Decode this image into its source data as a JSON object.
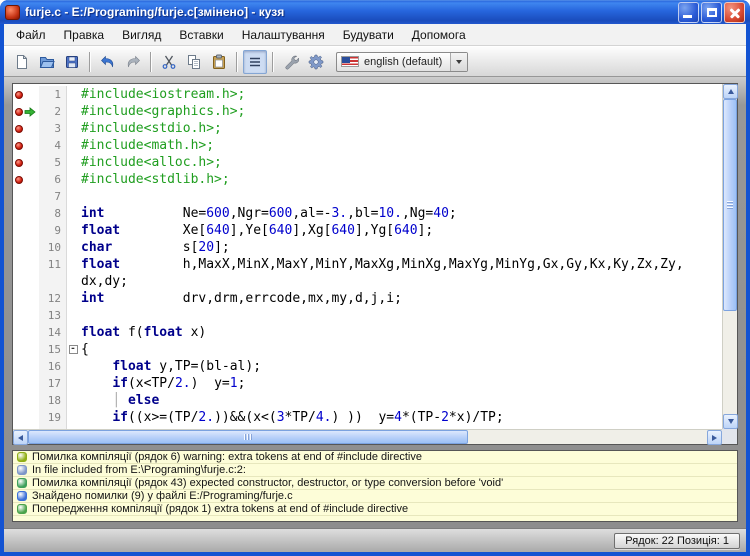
{
  "window": {
    "title": "furje.c - E:/Programing/furje.c[змінено] - кузя"
  },
  "menu": {
    "items": [
      "Файл",
      "Правка",
      "Вигляд",
      "Вставки",
      "Налаштування",
      "Будувати",
      "Допомога"
    ]
  },
  "toolbar": {
    "buttons": [
      {
        "name": "new-file",
        "icon": "new-document-icon"
      },
      {
        "name": "open-file",
        "icon": "open-folder-icon"
      },
      {
        "name": "save-file",
        "icon": "save-floppy-icon"
      },
      {
        "name": "undo",
        "icon": "undo-arrow-icon"
      },
      {
        "name": "redo",
        "icon": "redo-arrow-icon"
      },
      {
        "name": "cut",
        "icon": "scissors-icon"
      },
      {
        "name": "copy",
        "icon": "copy-icon"
      },
      {
        "name": "paste",
        "icon": "paste-clipboard-icon"
      },
      {
        "name": "output-panel-toggle",
        "icon": "list-lines-icon",
        "pressed": true
      },
      {
        "name": "build",
        "icon": "wrench-icon"
      },
      {
        "name": "run",
        "icon": "gear-icon"
      }
    ],
    "language_selector": {
      "value": "english (default)",
      "flag": "us-flag-icon"
    }
  },
  "colors": {
    "titlebar_blue": "#2766dd",
    "window_border_blue": "#1353d2",
    "error_marker_red": "#d21f10",
    "current_line_arrow_green": "#35b235",
    "output_panel_background": "#fdfdd8",
    "scrollbar_thumb_blue": "#b7cff9"
  },
  "editor": {
    "syntax_colors": {
      "keyword": "#00008b",
      "number": "#0000cd",
      "preprocessor": "#1f9e1f",
      "plain": "#000000",
      "guide": "#a8a8a8"
    },
    "lines": [
      {
        "num": "1",
        "marker": "error",
        "segments": [
          [
            "pre",
            "#include<iostream.h>;"
          ]
        ]
      },
      {
        "num": "2",
        "marker": "error-arrow",
        "segments": [
          [
            "pre",
            "#include<graphics.h>;"
          ]
        ]
      },
      {
        "num": "3",
        "marker": "error",
        "segments": [
          [
            "pre",
            "#include<stdio.h>;"
          ]
        ]
      },
      {
        "num": "4",
        "marker": "error",
        "segments": [
          [
            "pre",
            "#include<math.h>;"
          ]
        ]
      },
      {
        "num": "5",
        "marker": "error",
        "segments": [
          [
            "pre",
            "#include<alloc.h>;"
          ]
        ]
      },
      {
        "num": "6",
        "marker": "error",
        "segments": [
          [
            "pre",
            "#include<stdlib.h>;"
          ]
        ]
      },
      {
        "num": "7",
        "segments": []
      },
      {
        "num": "8",
        "segments": [
          [
            "kw",
            "int"
          ],
          [
            "plain",
            "          Ne="
          ],
          [
            "num",
            "600"
          ],
          [
            "plain",
            ",Ngr="
          ],
          [
            "num",
            "600"
          ],
          [
            "plain",
            ",al=-"
          ],
          [
            "num",
            "3."
          ],
          [
            "plain",
            ",bl="
          ],
          [
            "num",
            "10."
          ],
          [
            "plain",
            ",Ng="
          ],
          [
            "num",
            "40"
          ],
          [
            "plain",
            ";"
          ]
        ]
      },
      {
        "num": "9",
        "segments": [
          [
            "kw",
            "float"
          ],
          [
            "plain",
            "        Xe["
          ],
          [
            "num",
            "640"
          ],
          [
            "plain",
            "],Ye["
          ],
          [
            "num",
            "640"
          ],
          [
            "plain",
            "],Xg["
          ],
          [
            "num",
            "640"
          ],
          [
            "plain",
            "],Yg["
          ],
          [
            "num",
            "640"
          ],
          [
            "plain",
            "];"
          ]
        ]
      },
      {
        "num": "10",
        "segments": [
          [
            "kw",
            "char"
          ],
          [
            "plain",
            "         s["
          ],
          [
            "num",
            "20"
          ],
          [
            "plain",
            "];"
          ]
        ]
      },
      {
        "num": "11",
        "segments": [
          [
            "kw",
            "float"
          ],
          [
            "plain",
            "        h,MaxX,MinX,MaxY,MinY,MaxXg,MinXg,MaxYg,MinYg,Gx,Gy,Kx,Ky,Zx,Zy,"
          ]
        ]
      },
      {
        "num": "",
        "segments": [
          [
            "plain",
            "dx,dy;"
          ]
        ]
      },
      {
        "num": "12",
        "segments": [
          [
            "kw",
            "int"
          ],
          [
            "plain",
            "          drv,drm,errcode,mx,my,d,j,i;"
          ]
        ]
      },
      {
        "num": "13",
        "segments": []
      },
      {
        "num": "14",
        "segments": [
          [
            "kw",
            "float"
          ],
          [
            "plain",
            " f("
          ],
          [
            "kw",
            "float"
          ],
          [
            "plain",
            " x)"
          ]
        ]
      },
      {
        "num": "15",
        "fold": "-",
        "segments": [
          [
            "plain",
            "{"
          ]
        ]
      },
      {
        "num": "16",
        "segments": [
          [
            "plain",
            "    "
          ],
          [
            "kw",
            "float"
          ],
          [
            "plain",
            " y,TP=(bl-al);"
          ]
        ]
      },
      {
        "num": "17",
        "segments": [
          [
            "plain",
            "    "
          ],
          [
            "kw",
            "if"
          ],
          [
            "plain",
            "(x<TP/"
          ],
          [
            "num",
            "2."
          ],
          [
            "plain",
            ")  y="
          ],
          [
            "num",
            "1"
          ],
          [
            "plain",
            ";"
          ]
        ]
      },
      {
        "num": "18",
        "segments": [
          [
            "plain",
            "    "
          ],
          [
            "guide",
            "│"
          ],
          [
            "plain",
            " "
          ],
          [
            "kw",
            "else"
          ]
        ]
      },
      {
        "num": "19",
        "segments": [
          [
            "plain",
            "    "
          ],
          [
            "kw",
            "if"
          ],
          [
            "plain",
            "((x>=(TP/"
          ],
          [
            "num",
            "2."
          ],
          [
            "plain",
            "))&&(x<("
          ],
          [
            "num",
            "3"
          ],
          [
            "plain",
            "*TP/"
          ],
          [
            "num",
            "4."
          ],
          [
            "plain",
            ") ))  y="
          ],
          [
            "num",
            "4"
          ],
          [
            "plain",
            "*(TP-"
          ],
          [
            "num",
            "2"
          ],
          [
            "plain",
            "*x)/TP;"
          ]
        ]
      }
    ]
  },
  "messages": {
    "items": [
      {
        "icon": "compiler-warning-icon",
        "color": "#8fae12",
        "text": "Помилка компіляції (рядок 6) warning: extra tokens at end of #include directive"
      },
      {
        "icon": "info-icon",
        "color": "#7d96c8",
        "text": "In file included from E:\\Programing\\furje.c:2:"
      },
      {
        "icon": "compiler-error-icon",
        "color": "#3da05a",
        "text": "Помилка компіляції (рядок 43) expected constructor, destructor, or type conversion before 'void'"
      },
      {
        "icon": "file-errors-summary-icon",
        "color": "#3a6fd8",
        "text": "Знайдено помилки (9) у файлі E:/Programing/furje.c"
      },
      {
        "icon": "compiler-warning-icon",
        "color": "#4aa34a",
        "text": "Попередження компіляції (рядок 1) extra tokens at end of #include directive"
      }
    ]
  },
  "statusbar": {
    "position": "Рядок: 22 Позиція: 1"
  }
}
